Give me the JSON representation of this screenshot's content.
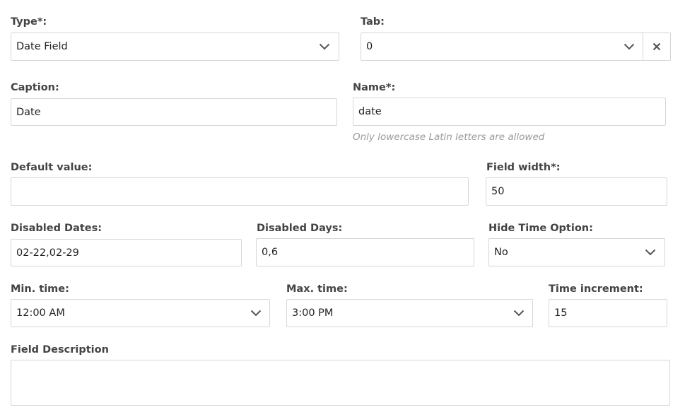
{
  "type": {
    "label": "Type*:",
    "value": "Date Field"
  },
  "tab": {
    "label": "Tab:",
    "value": "0"
  },
  "caption": {
    "label": "Caption:",
    "value": "Date"
  },
  "name": {
    "label": "Name*:",
    "value": "date",
    "hint": "Only lowercase Latin letters are allowed"
  },
  "default_value": {
    "label": "Default value:",
    "value": ""
  },
  "field_width": {
    "label": "Field width*:",
    "value": "50"
  },
  "disabled_dates": {
    "label": "Disabled Dates:",
    "value": "02-22,02-29"
  },
  "disabled_days": {
    "label": "Disabled Days:",
    "value": "0,6"
  },
  "hide_time": {
    "label": "Hide Time Option:",
    "value": "No"
  },
  "min_time": {
    "label": "Min. time:",
    "value": "12:00 AM"
  },
  "max_time": {
    "label": "Max. time:",
    "value": "3:00 PM"
  },
  "time_increment": {
    "label": "Time increment:",
    "value": "15"
  },
  "field_description": {
    "label": "Field Description",
    "value": ""
  },
  "icons": {
    "select_chevron": "chevron-down-icon",
    "clear": "close-icon"
  },
  "colors": {
    "border": "#d6d6d6",
    "label": "#444444",
    "hint": "#9a9a9a"
  }
}
